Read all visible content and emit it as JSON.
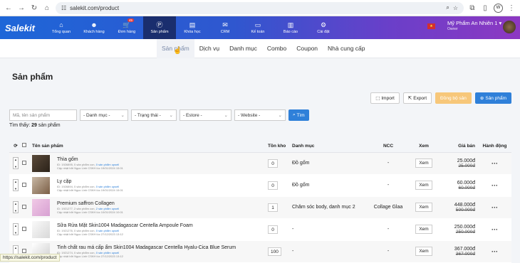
{
  "browser": {
    "url": "salekit.com/product",
    "profile": "W"
  },
  "nav": {
    "logo": "Salekit",
    "items": [
      {
        "label": "Tổng quan",
        "icon": "home-icon",
        "glyph": "⌂"
      },
      {
        "label": "Khách hàng",
        "icon": "users-icon",
        "glyph": "☻"
      },
      {
        "label": "Đơn hàng",
        "icon": "cart-icon",
        "glyph": "🛒",
        "badge": "45"
      },
      {
        "label": "Sản phẩm",
        "icon": "product-icon",
        "glyph": "Ⓟ",
        "active": true
      },
      {
        "label": "Khóa học",
        "icon": "book-icon",
        "glyph": "▤"
      },
      {
        "label": "CRM",
        "icon": "crm-icon",
        "glyph": "✉"
      },
      {
        "label": "Kế toán",
        "icon": "accounting-icon",
        "glyph": "▭"
      },
      {
        "label": "Báo cáo",
        "icon": "chart-icon",
        "glyph": "▥"
      },
      {
        "label": "Cài đặt",
        "icon": "gear-icon",
        "glyph": "⚙"
      }
    ],
    "shop_name": "Mỹ Phẩm An Nhiên 1",
    "role": "Owner"
  },
  "subnav": {
    "tabs": [
      "Sản phẩm",
      "Dịch vụ",
      "Danh mục",
      "Combo",
      "Coupon",
      "Nhà cung cấp"
    ]
  },
  "page": {
    "title": "Sản phẩm"
  },
  "actions": {
    "import": "Import",
    "export": "Export",
    "sync": "Đồng bộ sản",
    "add": "Sản phẩm"
  },
  "filters": {
    "search_placeholder": "Mã, tên sản phẩm",
    "category": "- Danh mục -",
    "status": "- Trạng thái -",
    "estore": "- Estore -",
    "website": "- Website -",
    "search_btn": "Tìm"
  },
  "found": {
    "label": "Tìm thấy:",
    "count": "29",
    "unit": "sản phẩm"
  },
  "table": {
    "headers": {
      "name": "Tên sản phẩm",
      "stock": "Tồn kho",
      "category": "Danh mục",
      "ncc": "NCC",
      "view": "Xem",
      "price": "Giá bán",
      "action": "Hành động"
    },
    "rows": [
      {
        "name": "Thìa gốm",
        "id": "ID: 1926895,",
        "variants": "0 sản phẩm con,",
        "upsell": "0 sản phẩm upsell",
        "updated": "Cập nhật bởi Ngọc Linh CSKH lúc 19/01/2024 15:01",
        "stock": "0",
        "category": "Đồ gốm",
        "ncc": "-",
        "view": "Xem",
        "price": "25.000đ",
        "old_price": "25.000đ"
      },
      {
        "name": "Ly cặp",
        "id": "ID: 1926894,",
        "variants": "0 sản phẩm con,",
        "upsell": "0 sản phẩm upsell",
        "updated": "Cập nhật bởi Ngọc Linh CSKH lúc 19/01/2024 15:01",
        "stock": "0",
        "category": "Đồ gốm",
        "ncc": "-",
        "view": "Xem",
        "price": "60.000đ",
        "old_price": "60.000đ"
      },
      {
        "name": "Premium saffron Collagen",
        "id": "ID: 1921277,",
        "variants": "2 sản phẩm con,",
        "upsell": "2 sản phẩm upsell",
        "updated": "Cập nhật bởi Ngọc Linh CSKH lúc 10/01/2024 10:01",
        "stock": "1",
        "category": "Chăm sóc body, danh mục 2",
        "ncc": "Collage Glaa",
        "view": "Xem",
        "price": "448.000đ",
        "old_price": "500.000đ"
      },
      {
        "name": "Sữa Rửa Mặt Skin1004 Madagascar Centella Ampoule Foam",
        "id": "ID: 1921276,",
        "variants": "0 sản phẩm con,",
        "upsell": "0 sản phẩm upsell",
        "updated": "Cập nhật bởi Ngọc Linh CSKH lúc 27/12/2023 13:12",
        "stock": "0",
        "category": "-",
        "ncc": "-",
        "view": "Xem",
        "price": "250.000đ",
        "old_price": "250.000đ"
      },
      {
        "name": "Tinh chất rau má cấp ẩm Skin1004 Madagascar Centella Hyalu-Cica Blue Serum",
        "id": "ID: 1921274,",
        "variants": "0 sản phẩm con,",
        "upsell": "0 sản phẩm upsell",
        "updated": "Cập nhật bởi Ngọc Linh CSKH lúc 27/12/2023 13:12",
        "stock": "100",
        "category": "-",
        "ncc": "-",
        "view": "Xem",
        "price": "367.000đ",
        "old_price": "367.000đ"
      }
    ]
  },
  "statusbar": "https://salekit.com/product",
  "colors": {
    "nav_start": "#1e66d8",
    "nav_end": "#8d38c2",
    "primary": "#2f80d9",
    "sync": "#f7c77a"
  }
}
